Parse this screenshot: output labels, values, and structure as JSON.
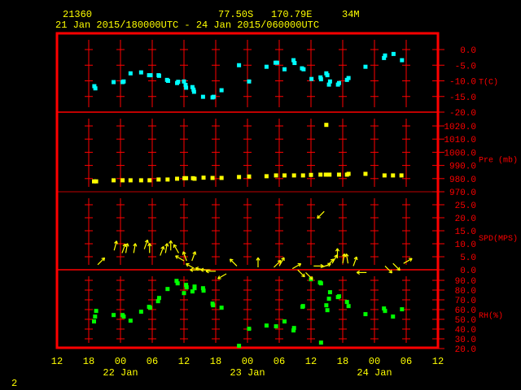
{
  "header": {
    "station": "21360",
    "lat": "77.50S",
    "lon": "170.79E",
    "elev": "34M",
    "period": "21 Jan 2015/180000UTC - 24 Jan 2015/060000UTC"
  },
  "footer": {
    "page_number": "2"
  },
  "colors": {
    "frame": "#ff0000",
    "text": "#ffff00",
    "temp": "#00ffff",
    "pressure": "#ffff00",
    "wind": "#ffff00",
    "rh": "#00ff00"
  },
  "chart_data": [
    {
      "type": "scatter",
      "title": "Temperature",
      "ylabel": "T(C)",
      "ylim": [
        -20,
        0
      ],
      "yticks": [
        "0.0",
        "-5.0",
        "-10.0",
        "-15.0",
        "-20.0"
      ],
      "x_units": "hours since 21 Jan 2015 12UTC",
      "points": [
        [
          7.06,
          -11.7
        ],
        [
          7.25,
          -12.4
        ],
        [
          10.7,
          -10.4
        ],
        [
          12.4,
          -10.4
        ],
        [
          12.6,
          -10.2
        ],
        [
          13.9,
          -7.6
        ],
        [
          15.9,
          -7.3
        ],
        [
          17.4,
          -8.2
        ],
        [
          17.7,
          -8.2
        ],
        [
          19.2,
          -8.2
        ],
        [
          19.3,
          -8.4
        ],
        [
          20.8,
          -9.7
        ],
        [
          21.0,
          -10.0
        ],
        [
          22.7,
          -10.7
        ],
        [
          22.9,
          -10.3
        ],
        [
          24.0,
          -10.2
        ],
        [
          24.3,
          -11.3
        ],
        [
          24.4,
          -12.2
        ],
        [
          25.6,
          -12.0
        ],
        [
          25.8,
          -12.8
        ],
        [
          25.9,
          -13.5
        ],
        [
          27.6,
          -15.1
        ],
        [
          29.4,
          -15.3
        ],
        [
          29.6,
          -15.1
        ],
        [
          31.1,
          -13.0
        ],
        [
          34.4,
          -5.0
        ],
        [
          36.3,
          -10.2
        ],
        [
          39.6,
          -5.5
        ],
        [
          41.3,
          -4.2
        ],
        [
          41.6,
          -4.2
        ],
        [
          43.0,
          -6.3
        ],
        [
          44.7,
          -3.4
        ],
        [
          44.9,
          -4.3
        ],
        [
          46.3,
          -6.0
        ],
        [
          46.6,
          -6.3
        ],
        [
          48.1,
          -9.4
        ],
        [
          49.8,
          -8.9
        ],
        [
          49.9,
          -9.5
        ],
        [
          50.9,
          -7.6
        ],
        [
          51.1,
          -8.2
        ],
        [
          51.6,
          -10.2
        ],
        [
          51.4,
          -11.2
        ],
        [
          53.1,
          -11.2
        ],
        [
          53.3,
          -10.7
        ],
        [
          54.8,
          -9.7
        ],
        [
          55.1,
          -9.1
        ],
        [
          58.3,
          -5.5
        ],
        [
          61.8,
          -2.7
        ],
        [
          62.0,
          -1.9
        ],
        [
          63.6,
          -1.4
        ],
        [
          65.2,
          -3.4
        ]
      ]
    },
    {
      "type": "scatter",
      "title": "Pressure",
      "ylabel": "Pre (mb)",
      "ylim": [
        970,
        1020
      ],
      "yticks": [
        "1020.0",
        "1010.0",
        "1000.0",
        "990.0",
        "980.0",
        "970.0"
      ],
      "x_units": "hours since 21 Jan 2015 12UTC",
      "points": [
        [
          7.0,
          977.9
        ],
        [
          7.4,
          977.9
        ],
        [
          10.7,
          978.7
        ],
        [
          12.4,
          978.7
        ],
        [
          13.9,
          978.7
        ],
        [
          15.9,
          978.7
        ],
        [
          17.5,
          978.7
        ],
        [
          19.2,
          979.3
        ],
        [
          20.9,
          979.3
        ],
        [
          22.7,
          979.9
        ],
        [
          24.1,
          980.3
        ],
        [
          24.4,
          980.3
        ],
        [
          25.7,
          980.3
        ],
        [
          26.0,
          979.9
        ],
        [
          27.7,
          980.7
        ],
        [
          29.4,
          980.5
        ],
        [
          31.1,
          980.5
        ],
        [
          34.4,
          981.2
        ],
        [
          36.3,
          981.6
        ],
        [
          39.6,
          981.8
        ],
        [
          41.4,
          982.4
        ],
        [
          43.0,
          982.4
        ],
        [
          44.8,
          982.4
        ],
        [
          46.5,
          982.4
        ],
        [
          48.0,
          982.8
        ],
        [
          49.8,
          983.0
        ],
        [
          50.8,
          983.0
        ],
        [
          51.5,
          983.0
        ],
        [
          53.3,
          983.0
        ],
        [
          54.8,
          983.0
        ],
        [
          55.1,
          983.6
        ],
        [
          58.3,
          983.6
        ],
        [
          61.9,
          982.4
        ],
        [
          63.5,
          982.4
        ],
        [
          65.1,
          982.4
        ],
        [
          50.9,
          1020.8
        ]
      ]
    },
    {
      "type": "vector",
      "title": "Wind speed",
      "ylabel": "SPD(MPS)",
      "ylim": [
        0,
        25
      ],
      "yticks": [
        "25.0",
        "20.0",
        "15.0",
        "10.0",
        "5.0",
        "0.0"
      ],
      "x_units": "hours since 21 Jan 2015 12UTC",
      "points_hour_speed_direction_deg": [
        [
          7.7,
          3.5,
          45
        ],
        [
          10.8,
          9,
          15
        ],
        [
          12.3,
          8,
          20
        ],
        [
          13.0,
          8,
          10
        ],
        [
          14.5,
          8,
          10
        ],
        [
          16.5,
          9.5,
          20
        ],
        [
          17.5,
          8,
          0
        ],
        [
          19.5,
          7,
          20
        ],
        [
          20.5,
          8,
          10
        ],
        [
          21.5,
          9,
          0
        ],
        [
          23.0,
          8,
          330
        ],
        [
          24.0,
          5,
          300
        ],
        [
          24.5,
          5,
          340
        ],
        [
          25.5,
          5,
          20
        ],
        [
          26.0,
          2,
          300
        ],
        [
          27.0,
          1.5,
          270
        ],
        [
          28.0,
          1.5,
          280
        ],
        [
          29.0,
          1.5,
          270
        ],
        [
          30.0,
          1,
          270
        ],
        [
          32.0,
          0,
          240
        ],
        [
          34.0,
          3,
          315
        ],
        [
          38.0,
          2.5,
          0
        ],
        [
          41.0,
          2.5,
          45
        ],
        [
          42.0,
          3,
          30
        ],
        [
          44.5,
          2,
          60
        ],
        [
          45.5,
          1.5,
          135
        ],
        [
          47.0,
          0.5,
          135
        ],
        [
          48.5,
          3,
          90
        ],
        [
          50.0,
          2.5,
          70
        ],
        [
          51.0,
          3,
          45
        ],
        [
          52.0,
          4,
          30
        ],
        [
          53.0,
          6,
          0
        ],
        [
          54.0,
          4,
          10
        ],
        [
          55.0,
          4,
          350
        ],
        [
          56.0,
          3,
          20
        ],
        [
          58.5,
          0.5,
          270
        ],
        [
          62.0,
          3,
          135
        ],
        [
          63.5,
          4,
          135
        ],
        [
          65.5,
          4,
          60
        ],
        [
          50.5,
          24,
          225
        ]
      ]
    },
    {
      "type": "scatter",
      "title": "Relative humidity",
      "ylabel": "RH(%)",
      "ylim": [
        20,
        90
      ],
      "yticks": [
        "90.0",
        "80.0",
        "70.0",
        "60.0",
        "50.0",
        "40.0",
        "30.0",
        "20.0"
      ],
      "x_units": "hours since 21 Jan 2015 12UTC",
      "points": [
        [
          7.4,
          58.6
        ],
        [
          7.2,
          52.8
        ],
        [
          7.0,
          47.8
        ],
        [
          10.7,
          54.4
        ],
        [
          12.4,
          54.4
        ],
        [
          12.6,
          52.8
        ],
        [
          13.9,
          48.6
        ],
        [
          15.9,
          57.8
        ],
        [
          17.4,
          62.8
        ],
        [
          17.6,
          61.9
        ],
        [
          19.1,
          68.6
        ],
        [
          19.3,
          71.9
        ],
        [
          20.9,
          81.1
        ],
        [
          22.6,
          89.4
        ],
        [
          22.8,
          86.9
        ],
        [
          24.0,
          76.9
        ],
        [
          24.4,
          85.3
        ],
        [
          24.5,
          82.8
        ],
        [
          25.6,
          78.6
        ],
        [
          26.0,
          83.6
        ],
        [
          26.0,
          81.9
        ],
        [
          27.6,
          81.9
        ],
        [
          27.7,
          79.4
        ],
        [
          29.4,
          66.1
        ],
        [
          29.5,
          64.4
        ],
        [
          31.1,
          61.9
        ],
        [
          34.4,
          22.8
        ],
        [
          36.3,
          40.3
        ],
        [
          39.6,
          43.6
        ],
        [
          41.4,
          42.8
        ],
        [
          43.0,
          47.8
        ],
        [
          44.7,
          38.6
        ],
        [
          44.8,
          41.1
        ],
        [
          46.4,
          62.8
        ],
        [
          46.5,
          63.6
        ],
        [
          48.0,
          91.1
        ],
        [
          49.7,
          87.8
        ],
        [
          49.9,
          86.9
        ],
        [
          49.9,
          26.1
        ],
        [
          50.9,
          64.4
        ],
        [
          51.1,
          59.4
        ],
        [
          51.4,
          71.1
        ],
        [
          51.6,
          77.8
        ],
        [
          53.1,
          72.8
        ],
        [
          53.3,
          73.6
        ],
        [
          54.8,
          67.8
        ],
        [
          55.1,
          63.6
        ],
        [
          58.3,
          55.3
        ],
        [
          61.8,
          61.1
        ],
        [
          62.0,
          58.6
        ],
        [
          63.5,
          52.8
        ],
        [
          65.2,
          60.3
        ]
      ]
    }
  ],
  "xaxis": {
    "tick_labels": [
      "12",
      "18",
      "00",
      "06",
      "12",
      "18",
      "00",
      "06",
      "12",
      "18",
      "00",
      "06",
      "12"
    ],
    "date_labels": [
      "22 Jan",
      "23 Jan",
      "24 Jan"
    ]
  }
}
